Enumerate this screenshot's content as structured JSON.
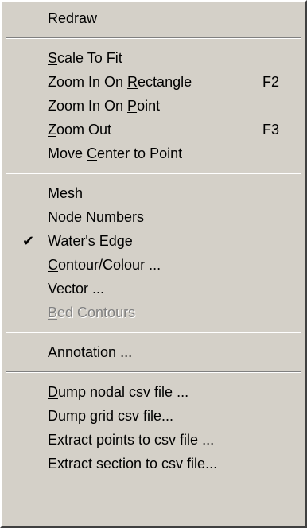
{
  "menu": {
    "groups": [
      {
        "items": [
          {
            "name": "redraw",
            "pre": "",
            "acc": "R",
            "post": "edraw",
            "shortcut": "",
            "checked": false,
            "disabled": false
          }
        ]
      },
      {
        "items": [
          {
            "name": "scale-to-fit",
            "pre": "",
            "acc": "S",
            "post": "cale To Fit",
            "shortcut": "",
            "checked": false,
            "disabled": false
          },
          {
            "name": "zoom-in-on-rectangle",
            "pre": "Zoom In On ",
            "acc": "R",
            "post": "ectangle",
            "shortcut": "F2",
            "checked": false,
            "disabled": false
          },
          {
            "name": "zoom-in-on-point",
            "pre": "Zoom In On ",
            "acc": "P",
            "post": "oint",
            "shortcut": "",
            "checked": false,
            "disabled": false
          },
          {
            "name": "zoom-out",
            "pre": "",
            "acc": "Z",
            "post": "oom Out",
            "shortcut": "F3",
            "checked": false,
            "disabled": false
          },
          {
            "name": "move-center-to-point",
            "pre": "Move ",
            "acc": "C",
            "post": "enter to Point",
            "shortcut": "",
            "checked": false,
            "disabled": false
          }
        ]
      },
      {
        "items": [
          {
            "name": "mesh",
            "pre": "Mesh",
            "acc": "",
            "post": "",
            "shortcut": "",
            "checked": false,
            "disabled": false
          },
          {
            "name": "node-numbers",
            "pre": "Node Numbers",
            "acc": "",
            "post": "",
            "shortcut": "",
            "checked": false,
            "disabled": false
          },
          {
            "name": "waters-edge",
            "pre": "Water's Edge",
            "acc": "",
            "post": "",
            "shortcut": "",
            "checked": true,
            "disabled": false
          },
          {
            "name": "contour-colour",
            "pre": "",
            "acc": "C",
            "post": "ontour/Colour ...",
            "shortcut": "",
            "checked": false,
            "disabled": false
          },
          {
            "name": "vector",
            "pre": "Vector ...",
            "acc": "",
            "post": "",
            "shortcut": "",
            "checked": false,
            "disabled": false
          },
          {
            "name": "bed-contours",
            "pre": "",
            "acc": "B",
            "post": "ed Contours",
            "shortcut": "",
            "checked": false,
            "disabled": true
          }
        ]
      },
      {
        "items": [
          {
            "name": "annotation",
            "pre": "Annotation ...",
            "acc": "",
            "post": "",
            "shortcut": "",
            "checked": false,
            "disabled": false
          }
        ]
      },
      {
        "items": [
          {
            "name": "dump-nodal-csv-file",
            "pre": "",
            "acc": "D",
            "post": "ump nodal csv file ...",
            "shortcut": "",
            "checked": false,
            "disabled": false
          },
          {
            "name": "dump-grid-csv-file",
            "pre": "Dump ",
            "acc": "g",
            "post": "rid csv file...",
            "shortcut": "",
            "checked": false,
            "disabled": false
          },
          {
            "name": "extract-points-to-csv-file",
            "pre": "Extract points to csv file ...",
            "acc": "",
            "post": "",
            "shortcut": "",
            "checked": false,
            "disabled": false
          },
          {
            "name": "extract-section-to-csv-file",
            "pre": "Extract section to csv file...",
            "acc": "",
            "post": "",
            "shortcut": "",
            "checked": false,
            "disabled": false
          }
        ]
      }
    ],
    "check_mark": "✔"
  }
}
